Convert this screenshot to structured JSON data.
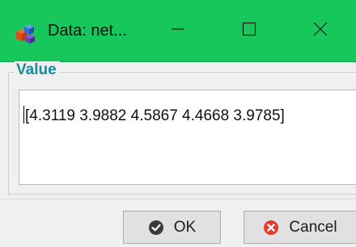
{
  "window": {
    "title": "Data: net...",
    "accent_color": "#17c75c",
    "controls": {
      "minimize_icon": "minimize-icon",
      "maximize_icon": "maximize-icon",
      "close_icon": "close-icon"
    }
  },
  "value_group": {
    "label": "Value",
    "text": "[4.3119 3.9882 4.5867 4.4668 3.9785]"
  },
  "buttons": {
    "ok_label": "OK",
    "ok_icon": "check-circle-icon",
    "cancel_label": "Cancel",
    "cancel_icon": "x-circle-icon"
  }
}
